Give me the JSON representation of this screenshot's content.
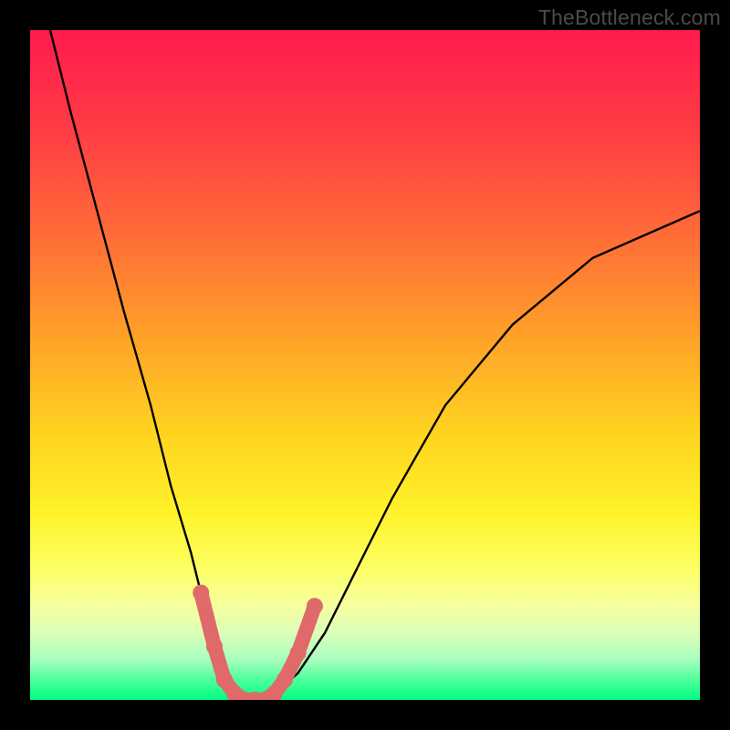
{
  "watermark": "TheBottleneck.com",
  "chart_data": {
    "type": "line",
    "title": "",
    "xlabel": "",
    "ylabel": "",
    "xlim": [
      0,
      100
    ],
    "ylim": [
      0,
      100
    ],
    "gradient_stops": [
      {
        "pos": 0,
        "color": "#ff1a4e"
      },
      {
        "pos": 14,
        "color": "#ff3a45"
      },
      {
        "pos": 30,
        "color": "#ff6a38"
      },
      {
        "pos": 46,
        "color": "#ffa228"
      },
      {
        "pos": 60,
        "color": "#ffd320"
      },
      {
        "pos": 72,
        "color": "#fff22a"
      },
      {
        "pos": 80,
        "color": "#fdff60"
      },
      {
        "pos": 86,
        "color": "#f6ffa0"
      },
      {
        "pos": 90,
        "color": "#dcffb8"
      },
      {
        "pos": 94,
        "color": "#a8ffc0"
      },
      {
        "pos": 97,
        "color": "#4eff9a"
      },
      {
        "pos": 100,
        "color": "#00ff83"
      }
    ],
    "series": [
      {
        "name": "bottleneck-curve",
        "x": [
          3,
          6,
          10,
          14,
          18,
          21,
          24,
          26,
          28,
          30,
          32,
          34,
          36,
          40,
          44,
          48,
          54,
          62,
          72,
          84,
          100
        ],
        "y": [
          100,
          88,
          73,
          58,
          44,
          32,
          22,
          14,
          8,
          3,
          0.5,
          0,
          0.5,
          4,
          10,
          18,
          30,
          44,
          56,
          66,
          73
        ]
      }
    ],
    "markers": {
      "name": "highlight-dots",
      "color": "#e06a6a",
      "points": [
        {
          "x": 25.5,
          "y": 16
        },
        {
          "x": 27.5,
          "y": 8
        },
        {
          "x": 29,
          "y": 3
        },
        {
          "x": 30.5,
          "y": 1
        },
        {
          "x": 32,
          "y": 0
        },
        {
          "x": 33.5,
          "y": 0
        },
        {
          "x": 35,
          "y": 0
        },
        {
          "x": 36.5,
          "y": 1
        },
        {
          "x": 38,
          "y": 3
        },
        {
          "x": 40,
          "y": 7
        },
        {
          "x": 42.5,
          "y": 14
        }
      ]
    }
  }
}
